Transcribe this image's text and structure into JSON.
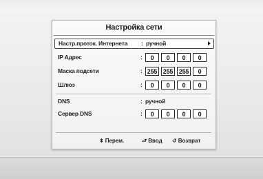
{
  "dialog": {
    "title": "Настройка сети"
  },
  "rows": {
    "protocol": {
      "label": "Настр.проток. Интернета",
      "colon": ":",
      "value": "ручной"
    },
    "ip": {
      "label": "IP Адрес",
      "colon": ":",
      "octets": [
        "0",
        "0",
        "0",
        "0"
      ]
    },
    "mask": {
      "label": "Маска подсети",
      "colon": ":",
      "octets": [
        "255",
        "255",
        "255",
        "0"
      ]
    },
    "gateway": {
      "label": "Шлюз",
      "colon": ":",
      "octets": [
        "0",
        "0",
        "0",
        "0"
      ]
    },
    "dns": {
      "label": "DNS",
      "colon": ":",
      "value": "ручной"
    },
    "dns_server": {
      "label": "Сервер DNS",
      "colon": ":",
      "octets": [
        "0",
        "0",
        "0",
        "0"
      ]
    }
  },
  "footer": {
    "move": {
      "icon": "updown-icon",
      "glyph": "⬍",
      "label": "Перем."
    },
    "enter": {
      "icon": "enter-icon",
      "glyph": "⮐",
      "label": "Ввод"
    },
    "back": {
      "icon": "return-icon",
      "glyph": "↺",
      "label": "Возврат"
    }
  }
}
